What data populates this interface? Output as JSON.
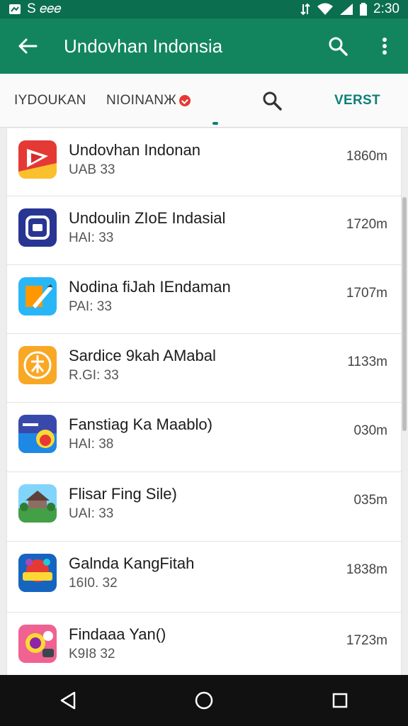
{
  "status_bar": {
    "left_text": "S 𝑒𝑒𝑒",
    "time": "2:30"
  },
  "app_bar": {
    "title": "Undovhan Indonsia",
    "icons": [
      "back-arrow-icon",
      "search-icon",
      "more-vert-icon"
    ]
  },
  "tabs": [
    {
      "label": "IYDOUKAN"
    },
    {
      "label": "NIOINANЖ"
    },
    {
      "icon": "search-icon"
    },
    {
      "label": "VERST",
      "active": true
    }
  ],
  "list": {
    "items": [
      {
        "name": "Undovhan Indonan",
        "sub": "UAB 33",
        "size": "1860m",
        "icon": "red-play-icon"
      },
      {
        "name": "Undoulin ZIoE Indasial",
        "sub": "HAI: 33",
        "size": "1720m",
        "icon": "blue-square-icon"
      },
      {
        "name": "Nodina fiJah IEndaman",
        "sub": "PAI: 33",
        "size": "1707m",
        "icon": "paint-brush-icon"
      },
      {
        "name": "Sardice 9kah AMabal",
        "sub": "R.GI: 33",
        "size": "1133m",
        "icon": "yellow-emblem-icon"
      },
      {
        "name": "Fanstiag Ka Maablo)",
        "sub": "HAI: 38",
        "size": "030m",
        "icon": "game-badge-icon"
      },
      {
        "name": "Flisar Fing Sile)",
        "sub": "UAI: 33",
        "size": "035m",
        "icon": "landscape-house-icon"
      },
      {
        "name": "Galnda KangFitah",
        "sub": "16I0. 32",
        "size": "1838m",
        "icon": "colorful-game-icon"
      },
      {
        "name": "Findaaa Yan()",
        "sub": "K9I8 32",
        "size": "1723m",
        "icon": "pink-game-icon"
      }
    ]
  },
  "colors": {
    "app_bar": "#12855f",
    "status_bar": "#0b6e4f",
    "active_tab": "#0e7f7a"
  },
  "nav_bar": {
    "icons": [
      "nav-back-icon",
      "nav-home-icon",
      "nav-recents-icon"
    ]
  }
}
